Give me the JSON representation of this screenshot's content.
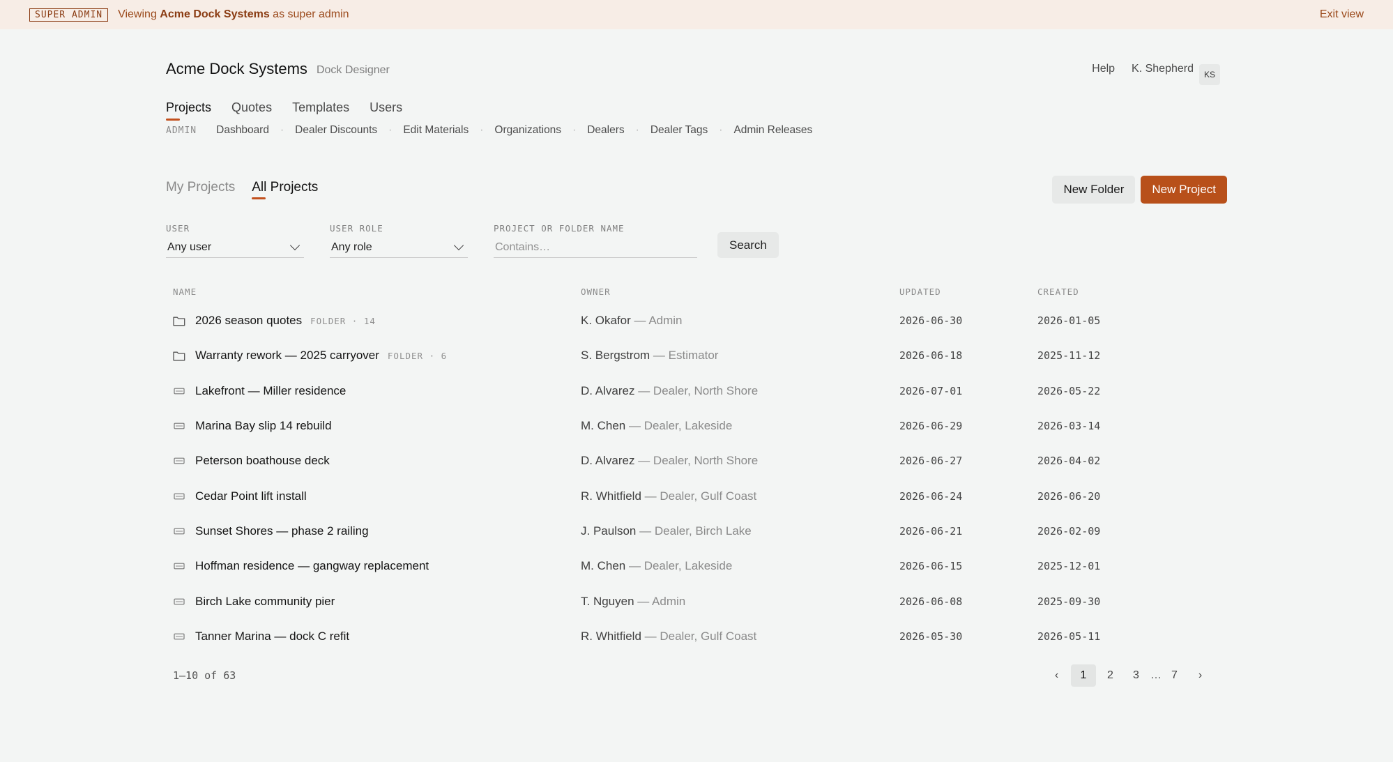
{
  "banner": {
    "badge": "SUPER ADMIN",
    "viewing_prefix": "Viewing",
    "org": "Acme Dock Systems",
    "viewing_suffix": "as super admin",
    "exit": "Exit view"
  },
  "header": {
    "brand": "Acme Dock Systems",
    "product": "Dock Designer",
    "help": "Help",
    "user_name": "K. Shepherd",
    "avatar_initials": "KS"
  },
  "main_nav": [
    "Projects",
    "Quotes",
    "Templates",
    "Users"
  ],
  "admin_nav": {
    "label": "ADMIN",
    "items": [
      "Dashboard",
      "Dealer Discounts",
      "Edit Materials",
      "Organizations",
      "Dealers",
      "Dealer Tags",
      "Admin Releases"
    ]
  },
  "subtabs": [
    "My Projects",
    "All Projects"
  ],
  "actions": {
    "new_folder": "New Folder",
    "new_project": "New Project"
  },
  "filters": {
    "user_label": "USER",
    "user_value": "Any user",
    "role_label": "USER ROLE",
    "role_value": "Any role",
    "name_label": "PROJECT OR FOLDER NAME",
    "name_placeholder": "Contains…",
    "search": "Search"
  },
  "table": {
    "columns": [
      "NAME",
      "OWNER",
      "UPDATED",
      "CREATED"
    ],
    "rows": [
      {
        "icon": "folder-icon",
        "name": "2026 season quotes",
        "meta": "FOLDER · 14",
        "owner": "K. Okafor",
        "role": " — Admin",
        "updated": "2026-06-30",
        "created": "2026-01-05"
      },
      {
        "icon": "folder-icon",
        "name": "Warranty rework — 2025 carryover",
        "meta": "FOLDER · 6",
        "owner": "S. Bergstrom",
        "role": " — Estimator",
        "updated": "2026-06-18",
        "created": "2025-11-12"
      },
      {
        "icon": "project-icon",
        "name": "Lakefront — Miller residence",
        "meta": "",
        "owner": "D. Alvarez",
        "role": " — Dealer, North Shore",
        "updated": "2026-07-01",
        "created": "2026-05-22"
      },
      {
        "icon": "project-icon",
        "name": "Marina Bay slip 14 rebuild",
        "meta": "",
        "owner": "M. Chen",
        "role": " — Dealer, Lakeside",
        "updated": "2026-06-29",
        "created": "2026-03-14"
      },
      {
        "icon": "project-icon",
        "name": "Peterson boathouse deck",
        "meta": "",
        "owner": "D. Alvarez",
        "role": " — Dealer, North Shore",
        "updated": "2026-06-27",
        "created": "2026-04-02"
      },
      {
        "icon": "project-icon",
        "name": "Cedar Point lift install",
        "meta": "",
        "owner": "R. Whitfield",
        "role": " — Dealer, Gulf Coast",
        "updated": "2026-06-24",
        "created": "2026-06-20"
      },
      {
        "icon": "project-icon",
        "name": "Sunset Shores — phase 2 railing",
        "meta": "",
        "owner": "J. Paulson",
        "role": " — Dealer, Birch Lake",
        "updated": "2026-06-21",
        "created": "2026-02-09"
      },
      {
        "icon": "project-icon",
        "name": "Hoffman residence — gangway replacement",
        "meta": "",
        "owner": "M. Chen",
        "role": " — Dealer, Lakeside",
        "updated": "2026-06-15",
        "created": "2025-12-01"
      },
      {
        "icon": "project-icon",
        "name": "Birch Lake community pier",
        "meta": "",
        "owner": "T. Nguyen",
        "role": " — Admin",
        "updated": "2026-06-08",
        "created": "2025-09-30"
      },
      {
        "icon": "project-icon",
        "name": "Tanner Marina — dock C refit",
        "meta": "",
        "owner": "R. Whitfield",
        "role": " — Dealer, Gulf Coast",
        "updated": "2026-05-30",
        "created": "2026-05-11"
      }
    ]
  },
  "pagination": {
    "summary": "1–10 of 63",
    "prev": "‹",
    "pages": [
      "1",
      "2",
      "3"
    ],
    "ellipsis": "…",
    "last": "7",
    "next": "›",
    "current": "1"
  },
  "colors": {
    "accent": "#b8501a",
    "banner_bg": "#f7ede6",
    "page_bg": "#f3f5f4"
  }
}
